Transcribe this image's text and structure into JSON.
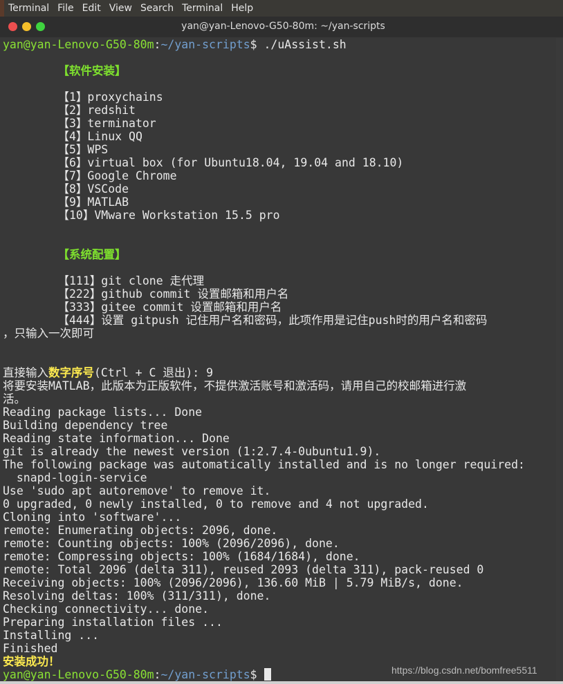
{
  "menubar": {
    "items": [
      "Terminal",
      "File",
      "Edit",
      "View",
      "Search",
      "Terminal",
      "Help"
    ]
  },
  "window": {
    "title": "yan@yan-Lenovo-G50-80m: ~/yan-scripts",
    "buttons": {
      "close": "#ed4f4f",
      "minimize": "#f5bf2a",
      "maximize": "#3fd33f"
    }
  },
  "colors": {
    "background": "#383838",
    "prompt_user": "#8ae234",
    "prompt_path": "#729fcf",
    "highlight": "#fce94f"
  },
  "terminal": {
    "lines": [
      [
        {
          "t": "yan@yan-Lenovo-G50-80m",
          "c": "g"
        },
        {
          "t": ":",
          "c": ""
        },
        {
          "t": "~/yan-scripts",
          "c": "b"
        },
        {
          "t": "$ ./uAssist.sh",
          "c": ""
        }
      ],
      [],
      [
        {
          "t": "        ",
          "c": ""
        },
        {
          "t": "【软件安装】",
          "c": "gb"
        }
      ],
      [],
      [
        {
          "t": "        【1】proxychains",
          "c": ""
        }
      ],
      [
        {
          "t": "        【2】redshit",
          "c": ""
        }
      ],
      [
        {
          "t": "        【3】terminator",
          "c": ""
        }
      ],
      [
        {
          "t": "        【4】Linux QQ",
          "c": ""
        }
      ],
      [
        {
          "t": "        【5】WPS",
          "c": ""
        }
      ],
      [
        {
          "t": "        【6】virtual box (for Ubuntu18.04, 19.04 and 18.10)",
          "c": ""
        }
      ],
      [
        {
          "t": "        【7】Google Chrome",
          "c": ""
        }
      ],
      [
        {
          "t": "        【8】VSCode",
          "c": ""
        }
      ],
      [
        {
          "t": "        【9】MATLAB",
          "c": ""
        }
      ],
      [
        {
          "t": "        【10】VMware Workstation 15.5 pro",
          "c": ""
        }
      ],
      [],
      [],
      [
        {
          "t": "        ",
          "c": ""
        },
        {
          "t": "【系统配置】",
          "c": "gb"
        }
      ],
      [],
      [
        {
          "t": "        【111】git clone 走代理",
          "c": ""
        }
      ],
      [
        {
          "t": "        【222】github commit 设置邮箱和用户名",
          "c": ""
        }
      ],
      [
        {
          "t": "        【333】gitee commit 设置邮箱和用户名",
          "c": ""
        }
      ],
      [
        {
          "t": "        【444】设置 gitpush 记住用户名和密码，此项作用是记住push时的用户名和密码",
          "c": ""
        }
      ],
      [
        {
          "t": "，只输入一次即可",
          "c": ""
        }
      ],
      [],
      [],
      [
        {
          "t": "直接输入",
          "c": ""
        },
        {
          "t": "数字序号",
          "c": "y"
        },
        {
          "t": "(Ctrl + C 退出): 9",
          "c": ""
        }
      ],
      [
        {
          "t": "将要安装MATLAB，此版本为正版软件，不提供激活账号和激活码，请用自己的校邮箱进行激",
          "c": ""
        }
      ],
      [
        {
          "t": "活。",
          "c": ""
        }
      ],
      [
        {
          "t": "Reading package lists... Done",
          "c": ""
        }
      ],
      [
        {
          "t": "Building dependency tree",
          "c": ""
        }
      ],
      [
        {
          "t": "Reading state information... Done",
          "c": ""
        }
      ],
      [
        {
          "t": "git is already the newest version (1:2.7.4-0ubuntu1.9).",
          "c": ""
        }
      ],
      [
        {
          "t": "The following package was automatically installed and is no longer required:",
          "c": ""
        }
      ],
      [
        {
          "t": "  snapd-login-service",
          "c": ""
        }
      ],
      [
        {
          "t": "Use 'sudo apt autoremove' to remove it.",
          "c": ""
        }
      ],
      [
        {
          "t": "0 upgraded, 0 newly installed, 0 to remove and 4 not upgraded.",
          "c": ""
        }
      ],
      [
        {
          "t": "Cloning into 'software'...",
          "c": ""
        }
      ],
      [
        {
          "t": "remote: Enumerating objects: 2096, done.",
          "c": ""
        }
      ],
      [
        {
          "t": "remote: Counting objects: 100% (2096/2096), done.",
          "c": ""
        }
      ],
      [
        {
          "t": "remote: Compressing objects: 100% (1684/1684), done.",
          "c": ""
        }
      ],
      [
        {
          "t": "remote: Total 2096 (delta 311), reused 2093 (delta 311), pack-reused 0",
          "c": ""
        }
      ],
      [
        {
          "t": "Receiving objects: 100% (2096/2096), 136.60 MiB | 5.79 MiB/s, done.",
          "c": ""
        }
      ],
      [
        {
          "t": "Resolving deltas: 100% (311/311), done.",
          "c": ""
        }
      ],
      [
        {
          "t": "Checking connectivity... done.",
          "c": ""
        }
      ],
      [
        {
          "t": "Preparing installation files ...",
          "c": ""
        }
      ],
      [
        {
          "t": "Installing ...",
          "c": ""
        }
      ],
      [
        {
          "t": "Finished",
          "c": ""
        }
      ],
      [
        {
          "t": "安装成功！",
          "c": "y"
        }
      ],
      [
        {
          "t": "yan@yan-Lenovo-G50-80m",
          "c": "g"
        },
        {
          "t": ":",
          "c": ""
        },
        {
          "t": "~/yan-scripts",
          "c": "b"
        },
        {
          "t": "$",
          "c": ""
        }
      ]
    ]
  },
  "watermark": "https://blog.csdn.net/bomfree5511"
}
